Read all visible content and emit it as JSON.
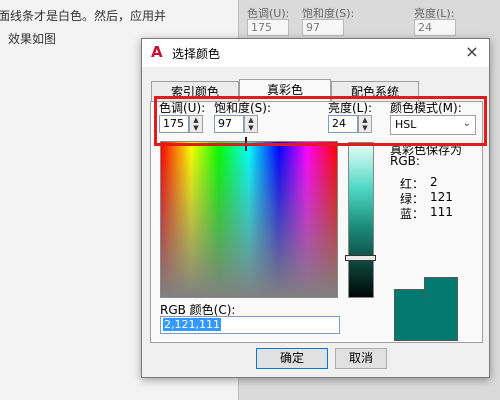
{
  "background": {
    "line1": "面线条才是白色。然后，应用并",
    "line2": "效果如图",
    "panel_labels": [
      "色调(U):",
      "饱和度(S):",
      "亮度(L):"
    ],
    "panel_values": [
      "175",
      "97",
      "24"
    ]
  },
  "dialog": {
    "title": "选择颜色",
    "close": "×",
    "tabs": [
      "索引颜色",
      "真彩色",
      "配色系统"
    ],
    "hue": {
      "label": "色调(U):",
      "value": "175"
    },
    "saturation": {
      "label": "饱和度(S):",
      "value": "97"
    },
    "luminance": {
      "label": "亮度(L):",
      "value": "24"
    },
    "color_model": {
      "label": "颜色模式(M):",
      "value": "HSL"
    },
    "truecolor_label": "真彩色保存为",
    "rgb_header": "RGB:",
    "red": {
      "label": "红：",
      "value": "2"
    },
    "green": {
      "label": "绿：",
      "value": "121"
    },
    "blue": {
      "label": "蓝：",
      "value": "111"
    },
    "rgb_color_label": "RGB 颜色(C):",
    "rgb_color_value": "2,121,111",
    "ok": "确定",
    "cancel": "取消"
  },
  "colors": {
    "current": "#027a6f",
    "highlight": "#e01c1c"
  }
}
